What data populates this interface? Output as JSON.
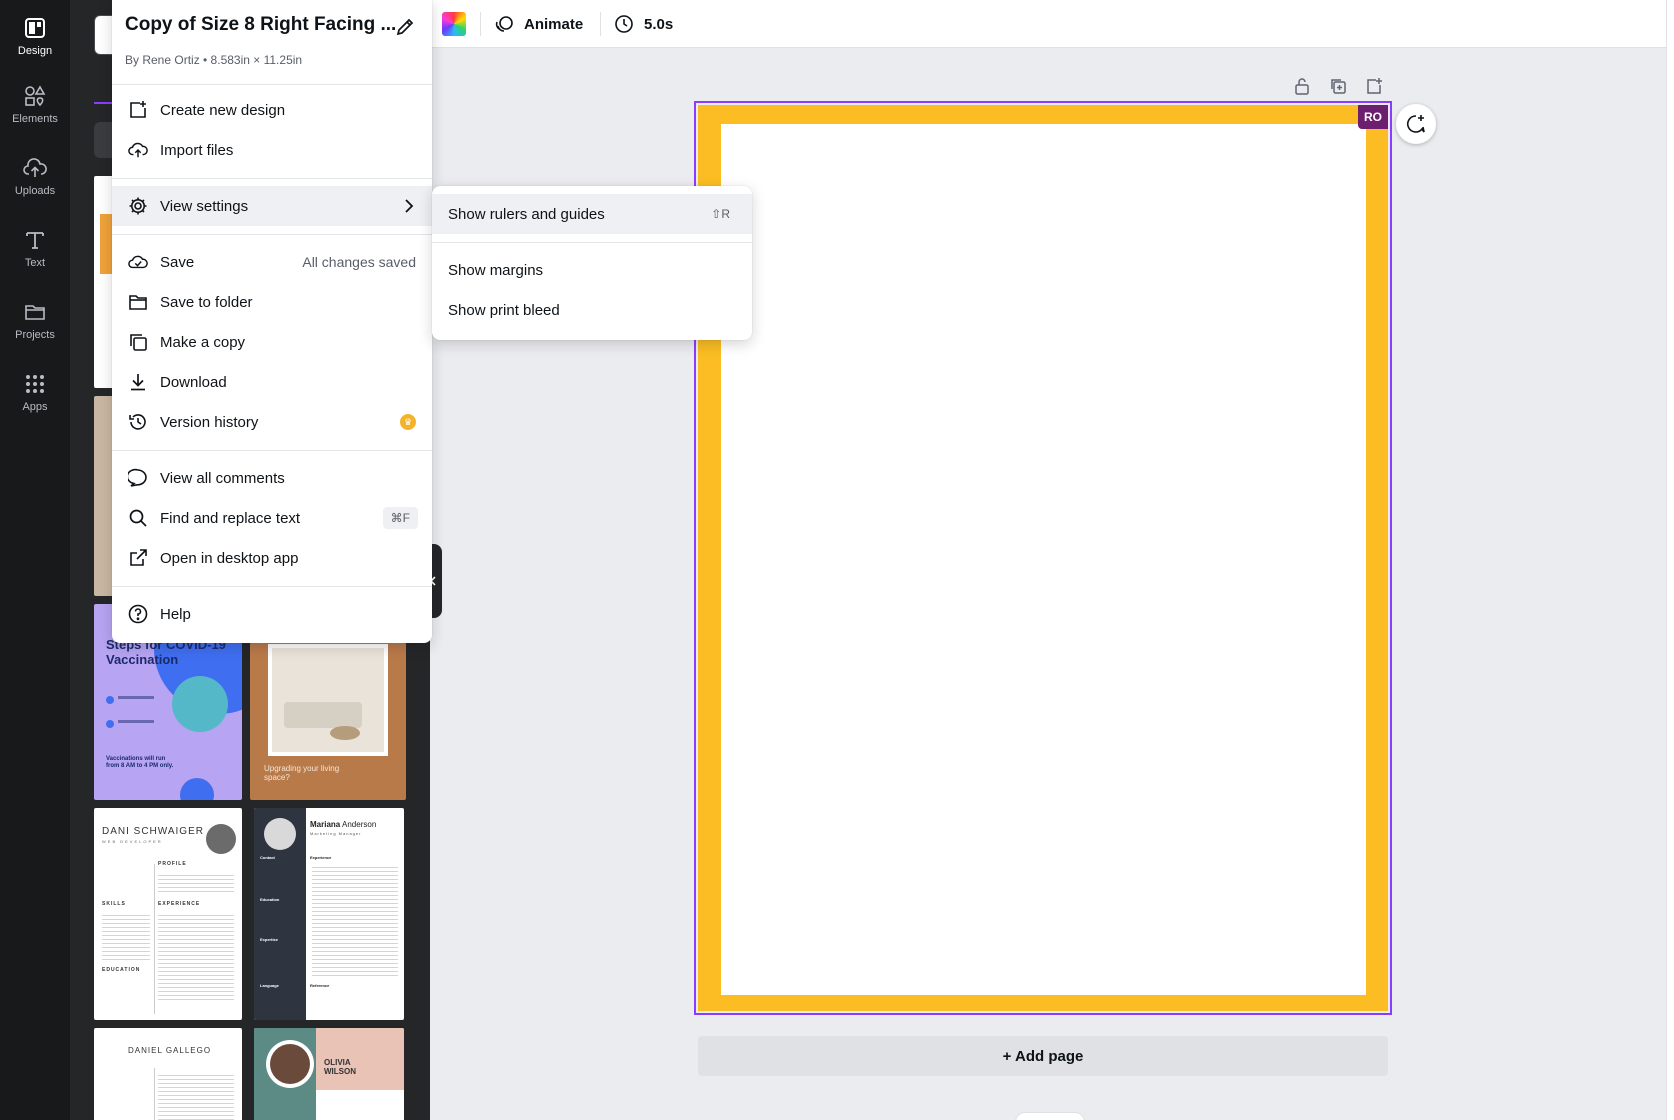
{
  "rail": {
    "items": [
      {
        "label": "Design",
        "icon": "design-icon",
        "active": true
      },
      {
        "label": "Elements",
        "icon": "elements-icon"
      },
      {
        "label": "Uploads",
        "icon": "cloud-upload-icon"
      },
      {
        "label": "Text",
        "icon": "text-icon"
      },
      {
        "label": "Projects",
        "icon": "folder-icon"
      },
      {
        "label": "Apps",
        "icon": "apps-grid-icon"
      }
    ]
  },
  "toolbar": {
    "color_icon": "color-picker-icon",
    "animate_label": "Animate",
    "duration_label": "5.0s"
  },
  "file_menu": {
    "title": "Copy of Size 8 Right Facing ...",
    "subtitle": "By Rene Ortiz • 8.583in × 11.25in",
    "items": {
      "create_new": "Create new design",
      "import_files": "Import files",
      "view_settings": "View settings",
      "save": "Save",
      "save_status": "All changes saved",
      "save_to_folder": "Save to folder",
      "make_copy": "Make a copy",
      "download": "Download",
      "version_history": "Version history",
      "view_comments": "View all comments",
      "find_replace": "Find and replace text",
      "find_replace_shortcut": "⌘F",
      "open_desktop": "Open in desktop app",
      "help": "Help"
    }
  },
  "view_settings_menu": {
    "show_rulers": "Show rulers and guides",
    "show_rulers_shortcut": "⇧R",
    "show_margins": "Show margins",
    "show_print_bleed": "Show print bleed"
  },
  "canvas": {
    "owner_initials": "RO",
    "add_page_label": "+ Add page",
    "border_color": "#fbbd23",
    "selection_color": "#8b3dff"
  },
  "templates": {
    "covid_title": "Steps for COVID-19 Vaccination",
    "covid_note": "Vaccinations will run from 8 AM to 4 PM only.",
    "living_space": "Upgrading your living space?",
    "dani_name": "DANI SCHWAIGER",
    "dani_role": "WEB DEVELOPER",
    "dani_sections": [
      "PROFILE",
      "EXPERIENCE",
      "SKILLS",
      "EDUCATION"
    ],
    "mariana_first": "Mariana",
    "mariana_last": "Anderson",
    "mariana_role": "Marketing Manager",
    "mariana_sections": [
      "Contact",
      "Experience",
      "Education",
      "Expertise",
      "Language",
      "Reference"
    ],
    "daniel_name": "DANIEL GALLEGO",
    "olivia_name": "OLIVIA WILSON"
  }
}
